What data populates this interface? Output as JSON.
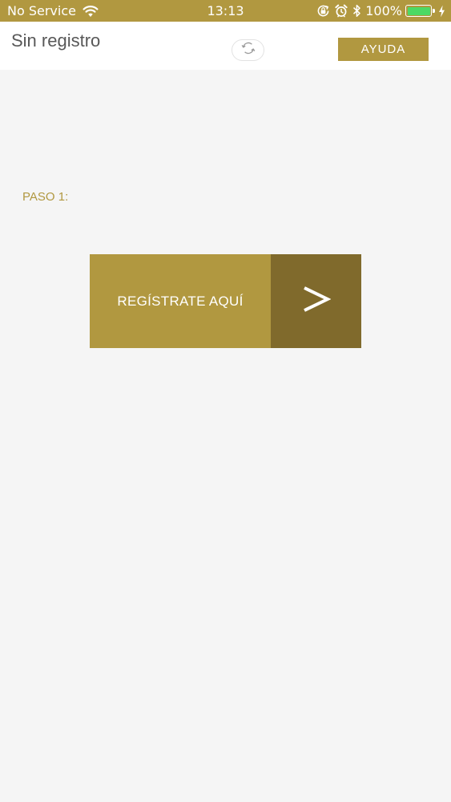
{
  "status_bar": {
    "carrier": "No Service",
    "time": "13:13",
    "battery_percent": "100%",
    "battery_level": 1.0,
    "colors": {
      "background": "#b19840",
      "battery_fill": "#4cd964"
    },
    "icons": [
      "wifi-icon",
      "rotation-lock-icon",
      "alarm-icon",
      "bluetooth-icon",
      "battery-icon",
      "charging-bolt-icon"
    ]
  },
  "header": {
    "title": "Sin registro",
    "refresh_icon": "refresh-icon",
    "help_label": "AYUDA"
  },
  "main": {
    "step_label": "PASO 1:",
    "register_label": "REGÍSTRATE AQUÍ",
    "register_arrow": ">"
  },
  "colors": {
    "accent": "#b19840",
    "accent_dark": "#806a2c",
    "background": "#f5f5f5",
    "header_background": "#ffffff",
    "title_text": "#585858"
  }
}
